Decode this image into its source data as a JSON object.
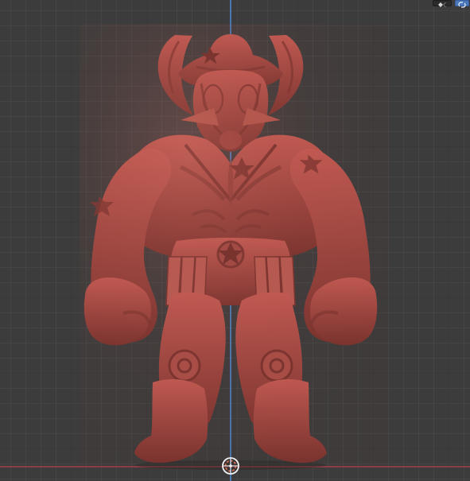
{
  "viewport": {
    "background": "#3c3c3c",
    "axes": {
      "z_color": "#4b79b7",
      "x_color": "#8d3e4a"
    }
  },
  "model": {
    "material_color": "#9f4741",
    "highlight_color": "#c9675d",
    "shadow_color": "#6f2d29"
  },
  "top_controls": {
    "icons": [
      "viewport-shading-icon",
      "link-icon"
    ]
  },
  "origin": {
    "icon": "origin-icon"
  }
}
